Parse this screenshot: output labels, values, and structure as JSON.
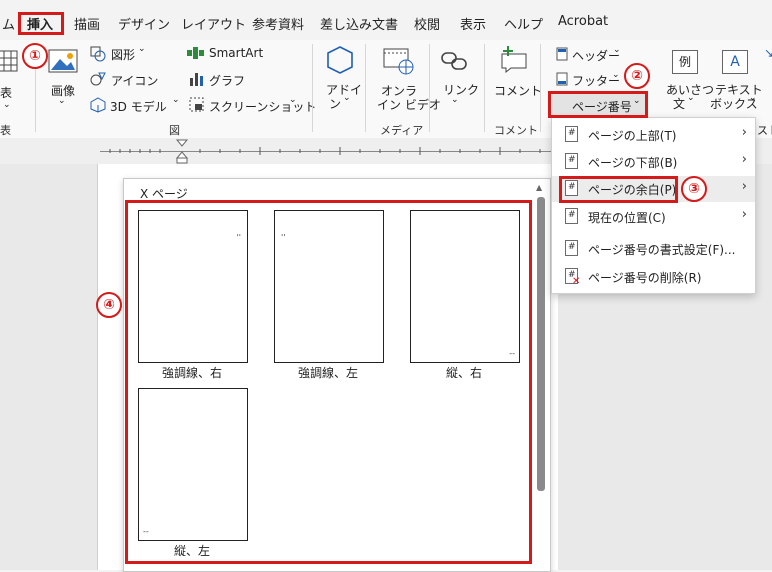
{
  "tabs": [
    "ム",
    "挿入",
    "描画",
    "デザイン",
    "レイアウト",
    "参考資料",
    "差し込み文書",
    "校閲",
    "表示",
    "ヘルプ",
    "Acrobat"
  ],
  "ribbon": {
    "table": "表",
    "table_group": "表",
    "image": "画像",
    "shapes": "図形",
    "icons": "アイコン",
    "model3d": "3D モデル",
    "smartart": "SmartArt",
    "graph": "グラフ",
    "screenshot": "スクリーンショット",
    "figure_group": "図",
    "addin_1": "アドイ",
    "addin_2": "ン",
    "video_1": "オンラ",
    "video_2": "イン ビデオ",
    "media_group": "メディア",
    "link": "リンク",
    "comment": "コメント",
    "comment_group": "コメント",
    "header": "ヘッダー",
    "footer": "フッター",
    "page_number": "ページ番号",
    "greeting_1": "あいさつ",
    "greeting_2": "文",
    "textbox_1": "テキスト",
    "textbox_2": "ボックス",
    "cut_text": "スト",
    "example_icon": "例",
    "textbox_icon": "A"
  },
  "menu": [
    {
      "label": "ページの上部(T)"
    },
    {
      "label": "ページの下部(B)"
    },
    {
      "label": "ページの余白(P)"
    },
    {
      "label": "現在の位置(C)"
    },
    {
      "label": "ページ番号の書式設定(F)..."
    },
    {
      "label": "ページ番号の削除(R)"
    }
  ],
  "gallery": {
    "header": "X ページ",
    "items": [
      {
        "label": "強調線、右",
        "mark": "''"
      },
      {
        "label": "強調線、左",
        "mark": "''"
      },
      {
        "label": "縦、右",
        "mark": "--"
      },
      {
        "label": "縦、左",
        "mark": "--"
      }
    ]
  },
  "badges": [
    "①",
    "②",
    "③",
    "④"
  ],
  "colors": {
    "annotation_red": "#d51a1a",
    "accent_blue": "#1f5fb4"
  }
}
